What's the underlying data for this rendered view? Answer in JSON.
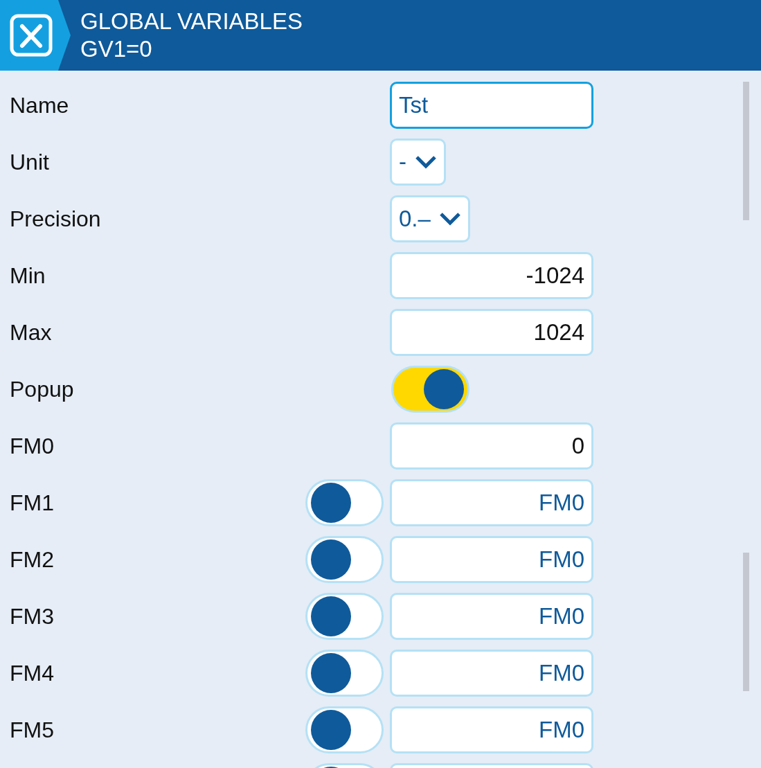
{
  "header": {
    "title": "GLOBAL VARIABLES",
    "subtitle": "GV1=0"
  },
  "rows": [
    {
      "kind": "text",
      "label": "Name",
      "value": "Tst",
      "focused": true
    },
    {
      "kind": "select",
      "label": "Unit",
      "value": "-"
    },
    {
      "kind": "select",
      "label": "Precision",
      "value": "0.–"
    },
    {
      "kind": "number",
      "label": "Min",
      "value": "-1024"
    },
    {
      "kind": "number",
      "label": "Max",
      "value": "1024"
    },
    {
      "kind": "switch",
      "label": "Popup",
      "on": true
    },
    {
      "kind": "number",
      "label": "FM0",
      "value": "0"
    },
    {
      "kind": "mode",
      "label": "FM1",
      "on": false,
      "value": "FM0"
    },
    {
      "kind": "mode",
      "label": "FM2",
      "on": false,
      "value": "FM0"
    },
    {
      "kind": "mode",
      "label": "FM3",
      "on": false,
      "value": "FM0"
    },
    {
      "kind": "mode",
      "label": "FM4",
      "on": false,
      "value": "FM0"
    },
    {
      "kind": "mode",
      "label": "FM5",
      "on": false,
      "value": "FM0"
    },
    {
      "kind": "partial",
      "on": false
    }
  ]
}
